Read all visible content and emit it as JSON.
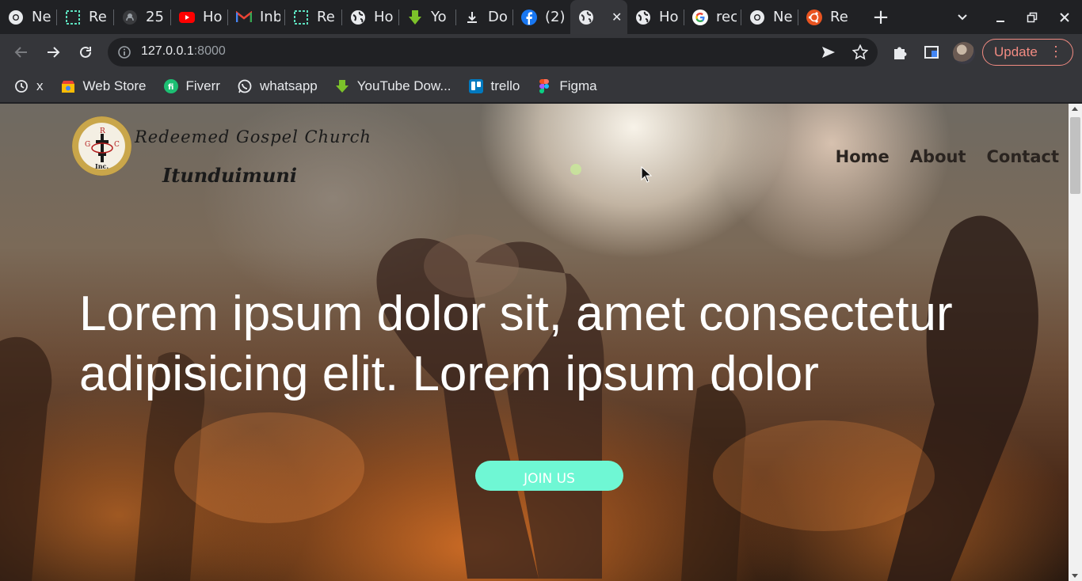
{
  "browser": {
    "tabs": [
      {
        "title": "Ne",
        "icon": "chrome-icon"
      },
      {
        "title": "Re",
        "icon": "replit-icon"
      },
      {
        "title": "25",
        "icon": "github-icon"
      },
      {
        "title": "Ho",
        "icon": "youtube-icon"
      },
      {
        "title": "Inb",
        "icon": "gmail-icon"
      },
      {
        "title": "Re",
        "icon": "replit-icon"
      },
      {
        "title": "Ho",
        "icon": "globe-icon"
      },
      {
        "title": "Yo",
        "icon": "download-arrow-icon"
      },
      {
        "title": "Do",
        "icon": "download-icon"
      },
      {
        "title": "(2)",
        "icon": "facebook-icon"
      },
      {
        "title": "",
        "icon": "globe-icon",
        "active": true
      },
      {
        "title": "Ho",
        "icon": "globe-icon"
      },
      {
        "title": "rec",
        "icon": "google-icon"
      },
      {
        "title": "Ne",
        "icon": "chrome-icon"
      },
      {
        "title": "Re",
        "icon": "ubuntu-icon"
      }
    ],
    "new_tab_label": "+",
    "address": {
      "host": "127.0.0.1",
      "port": ":8000"
    },
    "update_label": "Update",
    "bookmarks": [
      {
        "label": "x",
        "icon": "history-icon"
      },
      {
        "label": "Web Store",
        "icon": "webstore-icon"
      },
      {
        "label": "Fiverr",
        "icon": "fiverr-icon"
      },
      {
        "label": "whatsapp",
        "icon": "whatsapp-icon"
      },
      {
        "label": "YouTube Dow...",
        "icon": "download-arrow-icon"
      },
      {
        "label": "trello",
        "icon": "trello-icon"
      },
      {
        "label": "Figma",
        "icon": "figma-icon"
      }
    ]
  },
  "page": {
    "logo_letters": {
      "top": "R",
      "left": "G",
      "right": "C",
      "bottom": "Inc."
    },
    "brand_line1": "Redeemed Gospel Church",
    "brand_line2": "Itunduimuni",
    "nav": [
      "Home",
      "About",
      "Contact"
    ],
    "hero_text": "Lorem ipsum dolor sit, amet consectetur adipisicing elit. Lorem ipsum dolor",
    "cta_label": "JOIN US"
  },
  "colors": {
    "cta": "#6ff7d4",
    "update_accent": "#f28b82",
    "chrome_dark": "#202124",
    "chrome_toolbar": "#35363a"
  }
}
